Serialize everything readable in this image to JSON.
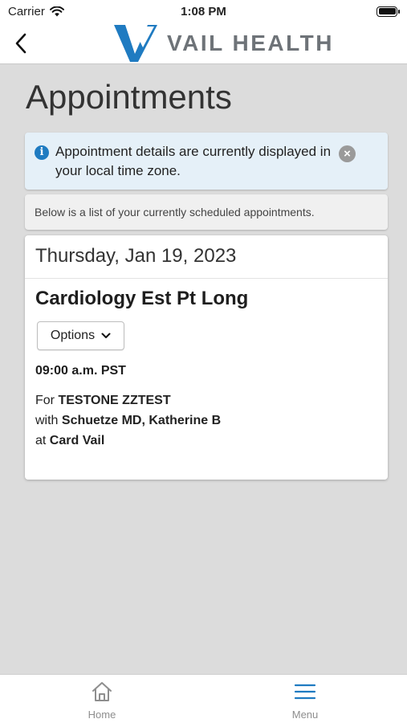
{
  "status_bar": {
    "carrier": "Carrier",
    "time": "1:08 PM"
  },
  "header": {
    "logo_text": "VAIL HEALTH"
  },
  "page": {
    "title": "Appointments"
  },
  "info_alert": {
    "text": "Appointment details are currently displayed in your local time zone."
  },
  "list_intro": "Below is a list of your currently scheduled appointments.",
  "appointment": {
    "date": "Thursday, Jan 19, 2023",
    "title": "Cardiology Est Pt Long",
    "options_label": "Options",
    "time": "09:00 a.m. PST",
    "for_prefix": "For",
    "patient": "TESTONE ZZTEST",
    "with_prefix": "with",
    "provider": "Schuetze MD, Katherine B",
    "at_prefix": "at",
    "location": "Card Vail"
  },
  "tab_bar": {
    "home_label": "Home",
    "menu_label": "Menu"
  },
  "colors": {
    "brand_blue": "#1f7bc1",
    "logo_gray": "#6e7378",
    "alert_bg": "#e5f0f8"
  }
}
